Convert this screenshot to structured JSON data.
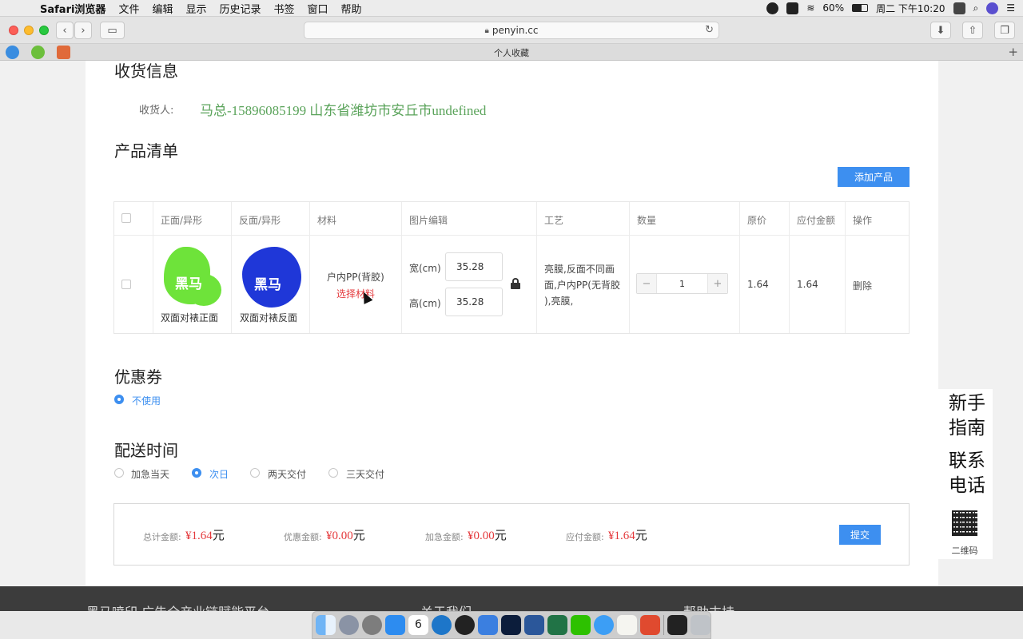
{
  "menubar": {
    "app": "Safari浏览器",
    "items": [
      "文件",
      "编辑",
      "显示",
      "历史记录",
      "书签",
      "窗口",
      "帮助"
    ],
    "battery": "60%",
    "datetime": "周二 下午10:20"
  },
  "browser": {
    "url": "penyin.cc",
    "favorites_title": "个人收藏"
  },
  "shipping": {
    "heading": "收货信息",
    "receiver_label": "收货人:",
    "receiver_value": "马总-15896085199 山东省潍坊市安丘市undefined"
  },
  "products": {
    "heading": "产品清单",
    "add_button": "添加产品",
    "columns": [
      "正面/异形",
      "反面/异形",
      "材料",
      "图片编辑",
      "工艺",
      "数量",
      "原价",
      "应付金额",
      "操作"
    ],
    "row": {
      "front_image_text": "黑马",
      "front_caption": "双面对裱正面",
      "back_image_text": "黑马",
      "back_caption": "双面对裱反面",
      "material": "户内PP(背胶)",
      "select_material": "选择材料",
      "width_label": "宽(cm)",
      "width_value": "35.28",
      "height_label": "高(cm)",
      "height_value": "35.28",
      "craft_lines": [
        "亮膜,反面不同画",
        "面,户内PP(无背胶",
        "),亮膜,"
      ],
      "quantity": "1",
      "qty_minus": "−",
      "qty_plus": "+",
      "original_price": "1.64",
      "payable": "1.64",
      "action": "删除"
    }
  },
  "coupon": {
    "heading": "优惠券",
    "option": "不使用"
  },
  "delivery": {
    "heading": "配送时间",
    "options": [
      "加急当天",
      "次日",
      "两天交付",
      "三天交付"
    ],
    "selected": "次日"
  },
  "summary": {
    "total_label": "总计金额:",
    "total_value": "¥1.64",
    "discount_label": "优惠金额:",
    "discount_value": "¥0.00",
    "rush_label": "加急金额:",
    "rush_value": "¥0.00",
    "payable_label": "应付金额:",
    "payable_value": "¥1.64",
    "unit": "元",
    "submit": "提交"
  },
  "side": {
    "guide_1": "新手",
    "guide_2": "指南",
    "contact_1": "联系",
    "contact_2": "电话",
    "qr_label": "二维码"
  },
  "footer": {
    "col1": "黑马喷印 广告全产业链赋能平台",
    "col2": "关于我们",
    "col3": "帮助支持"
  },
  "colors": {
    "accent": "#3d8ff0",
    "price_red": "#e4393c",
    "receiver_green": "#5aa35a",
    "front_blob": "#6ee33a",
    "back_blob": "#1f37d8"
  },
  "dock_icons": [
    "finder-icon",
    "launchpad-icon",
    "system-preferences-icon",
    "app-store-icon",
    "calendar-icon",
    "edge-icon",
    "qq-icon",
    "finder-alt-icon",
    "photoshop-icon",
    "word-icon",
    "excel-icon",
    "wechat-icon",
    "safari-icon",
    "notes-icon",
    "wps-icon",
    "terminal-icon",
    "trash-icon"
  ],
  "calendar_day": "6"
}
